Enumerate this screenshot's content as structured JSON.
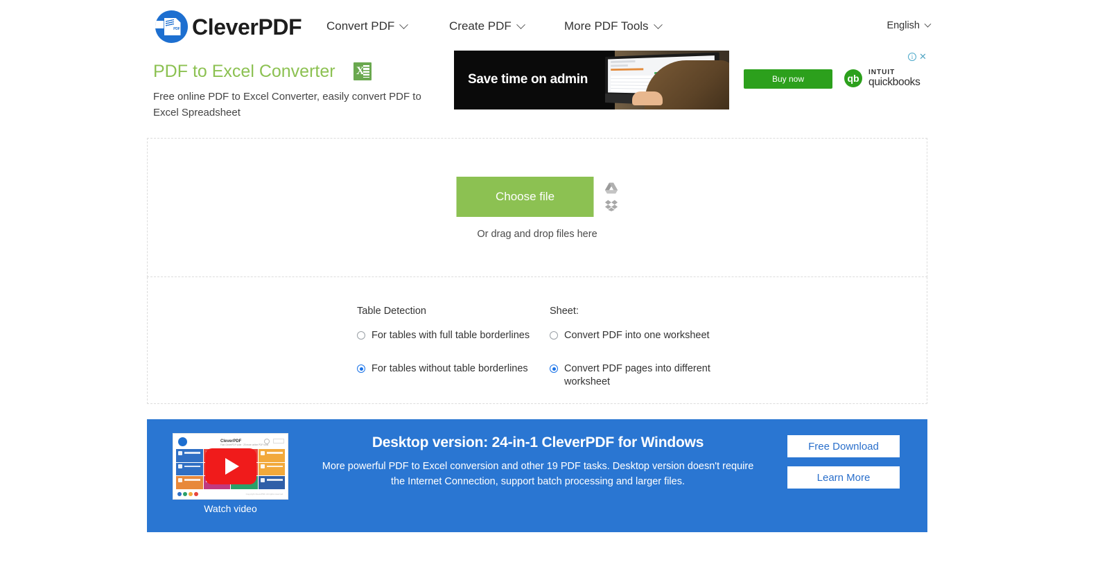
{
  "header": {
    "logo_text": "CleverPDF",
    "logo_icon": "cleverpdf-logo-icon",
    "nav": [
      {
        "label": "Convert PDF",
        "icon": "chevron-down-icon"
      },
      {
        "label": "Create PDF",
        "icon": "chevron-down-icon"
      },
      {
        "label": "More PDF Tools",
        "icon": "chevron-down-icon"
      }
    ],
    "language": {
      "label": "English",
      "icon": "chevron-down-icon"
    }
  },
  "tool": {
    "title": "PDF to Excel Converter",
    "title_color": "#8cc152",
    "icon": "excel-file-icon",
    "subtitle": "Free online PDF to Excel Converter, easily convert PDF to Excel Spreadsheet"
  },
  "ad": {
    "headline": "Save time on admin",
    "cta_label": "Buy now",
    "cta_color": "#2ca01c",
    "brand_top": "INTUIT",
    "brand_bottom": "quickbooks",
    "brand_mark": "qb",
    "info_icon": "ad-info-icon",
    "info_glyph": "i",
    "close_icon": "ad-close-icon",
    "close_glyph": "✕"
  },
  "upload": {
    "choose_label": "Choose file",
    "choose_color": "#8cc152",
    "drag_text": "Or drag and drop files here",
    "cloud": [
      {
        "icon": "google-drive-icon",
        "name": "Google Drive"
      },
      {
        "icon": "dropbox-icon",
        "name": "Dropbox"
      }
    ]
  },
  "options": {
    "table_detection": {
      "heading": "Table Detection",
      "choices": [
        {
          "label": "For tables with full table borderlines",
          "selected": false
        },
        {
          "label": "For tables without table borderlines",
          "selected": true
        }
      ]
    },
    "sheet": {
      "heading": "Sheet:",
      "choices": [
        {
          "label": "Convert PDF into one worksheet",
          "selected": false
        },
        {
          "label": "Convert PDF pages into different worksheet",
          "selected": true
        }
      ]
    },
    "accent": "#1a73e8"
  },
  "banner": {
    "background": "#2a76d2",
    "title": "Desktop version: 24-in-1 CleverPDF for Windows",
    "description": "More powerful PDF to Excel conversion and other 19 PDF tasks. Desktop version doesn't require the Internet Connection, support batch processing and larger files.",
    "watch_label": "Watch video",
    "video": {
      "icon": "play-button-icon",
      "app_title": "CleverPDF",
      "app_sub": "Fast CleverPDF suite · 20 more online PDF tools",
      "copyright": "Copyright CleverPDF. All rights reserved.",
      "search_icon": "search-icon",
      "menu_icon": "menu-icon"
    },
    "buttons": [
      {
        "label": "Free Download"
      },
      {
        "label": "Learn More"
      }
    ]
  }
}
